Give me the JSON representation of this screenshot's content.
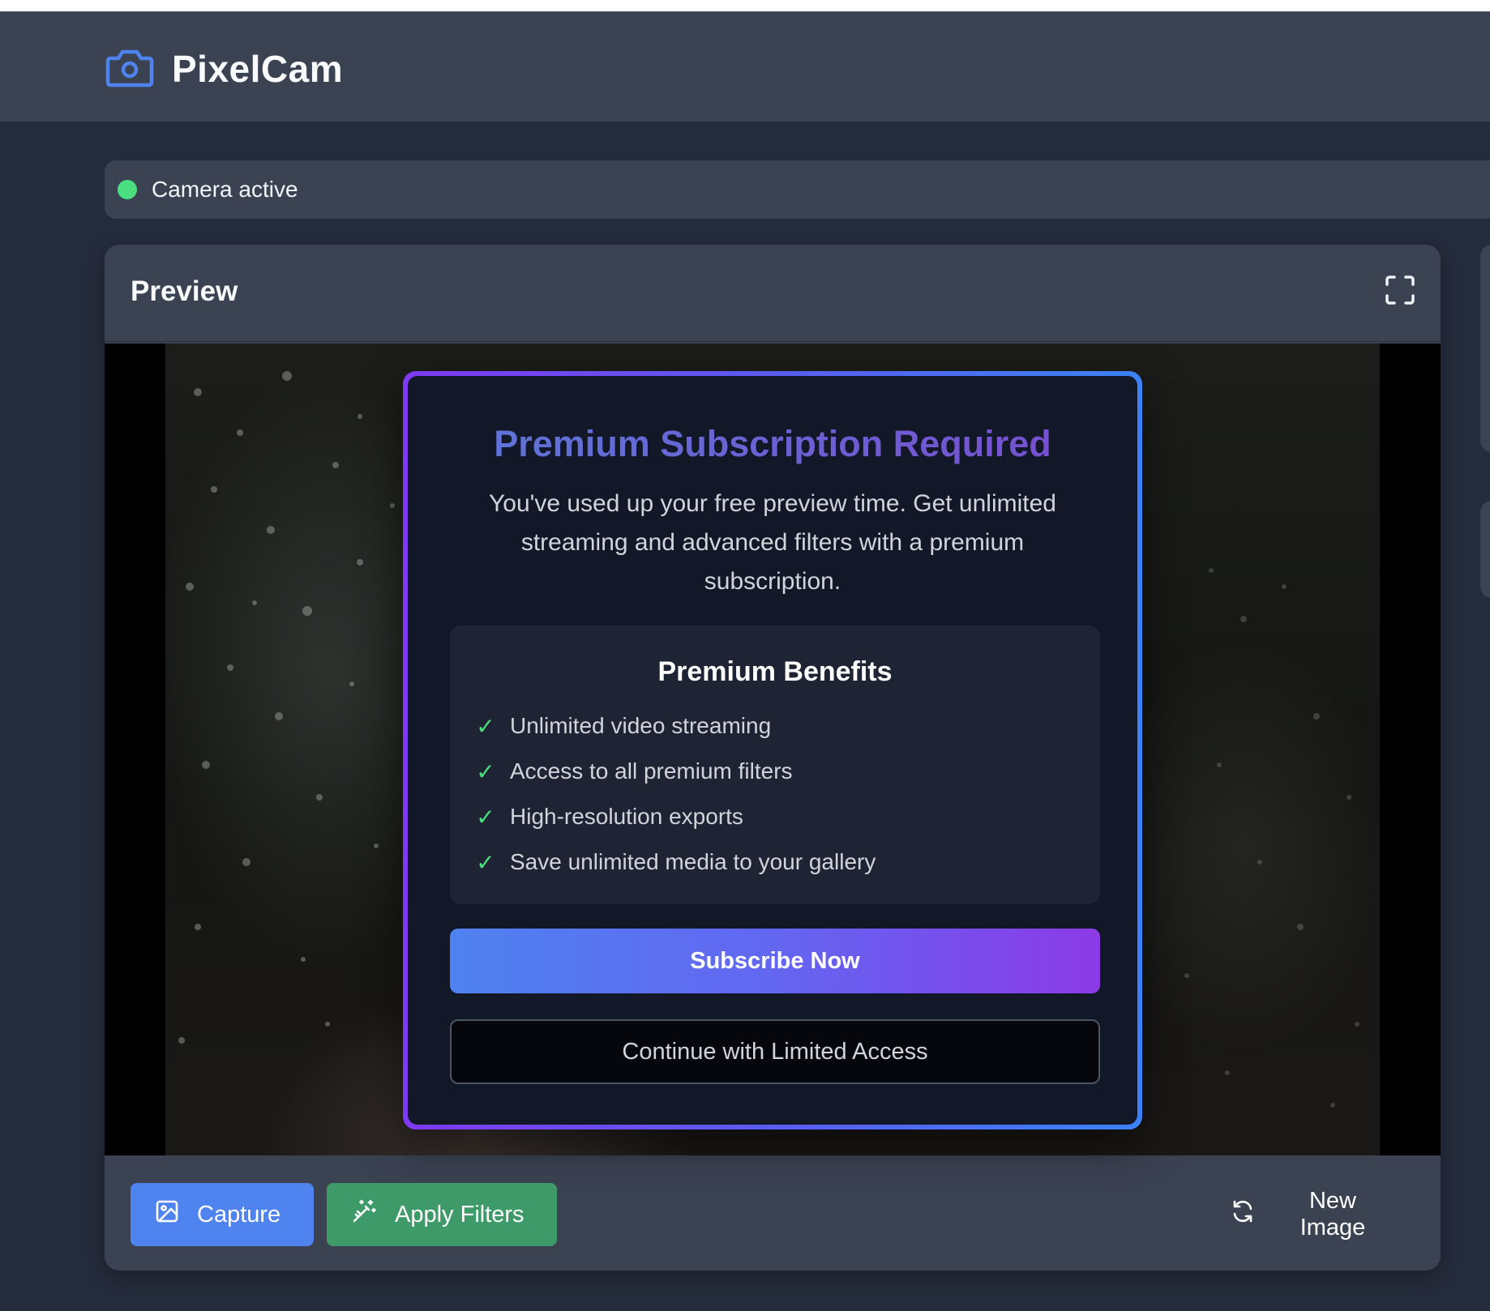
{
  "app": {
    "name": "PixelCam",
    "logo_icon": "camera-icon",
    "accent": "#3b82f6"
  },
  "status": {
    "text": "Camera active",
    "color": "#4ade80"
  },
  "preview": {
    "title": "Preview",
    "fullscreen_icon": "fullscreen-icon"
  },
  "modal": {
    "title": "Premium Subscription Required",
    "text": "You've used up your free preview time. Get unlimited streaming and advanced filters with a premium subscription.",
    "benefits_title": "Premium Benefits",
    "benefits": [
      "Unlimited video streaming",
      "Access to all premium filters",
      "High-resolution exports",
      "Save unlimited media to your gallery"
    ],
    "subscribe_label": "Subscribe Now",
    "limited_label": "Continue with Limited Access",
    "gradient": [
      "#3b82f6",
      "#7e3af2"
    ]
  },
  "toolbar": {
    "capture_label": "Capture",
    "capture_icon": "image-icon",
    "capture_color": "#4f83f0",
    "filters_label": "Apply Filters",
    "filters_icon": "magic-wand-icon",
    "filters_color": "#3f9a6a",
    "new_label": "New Image",
    "new_icon": "refresh-icon"
  }
}
